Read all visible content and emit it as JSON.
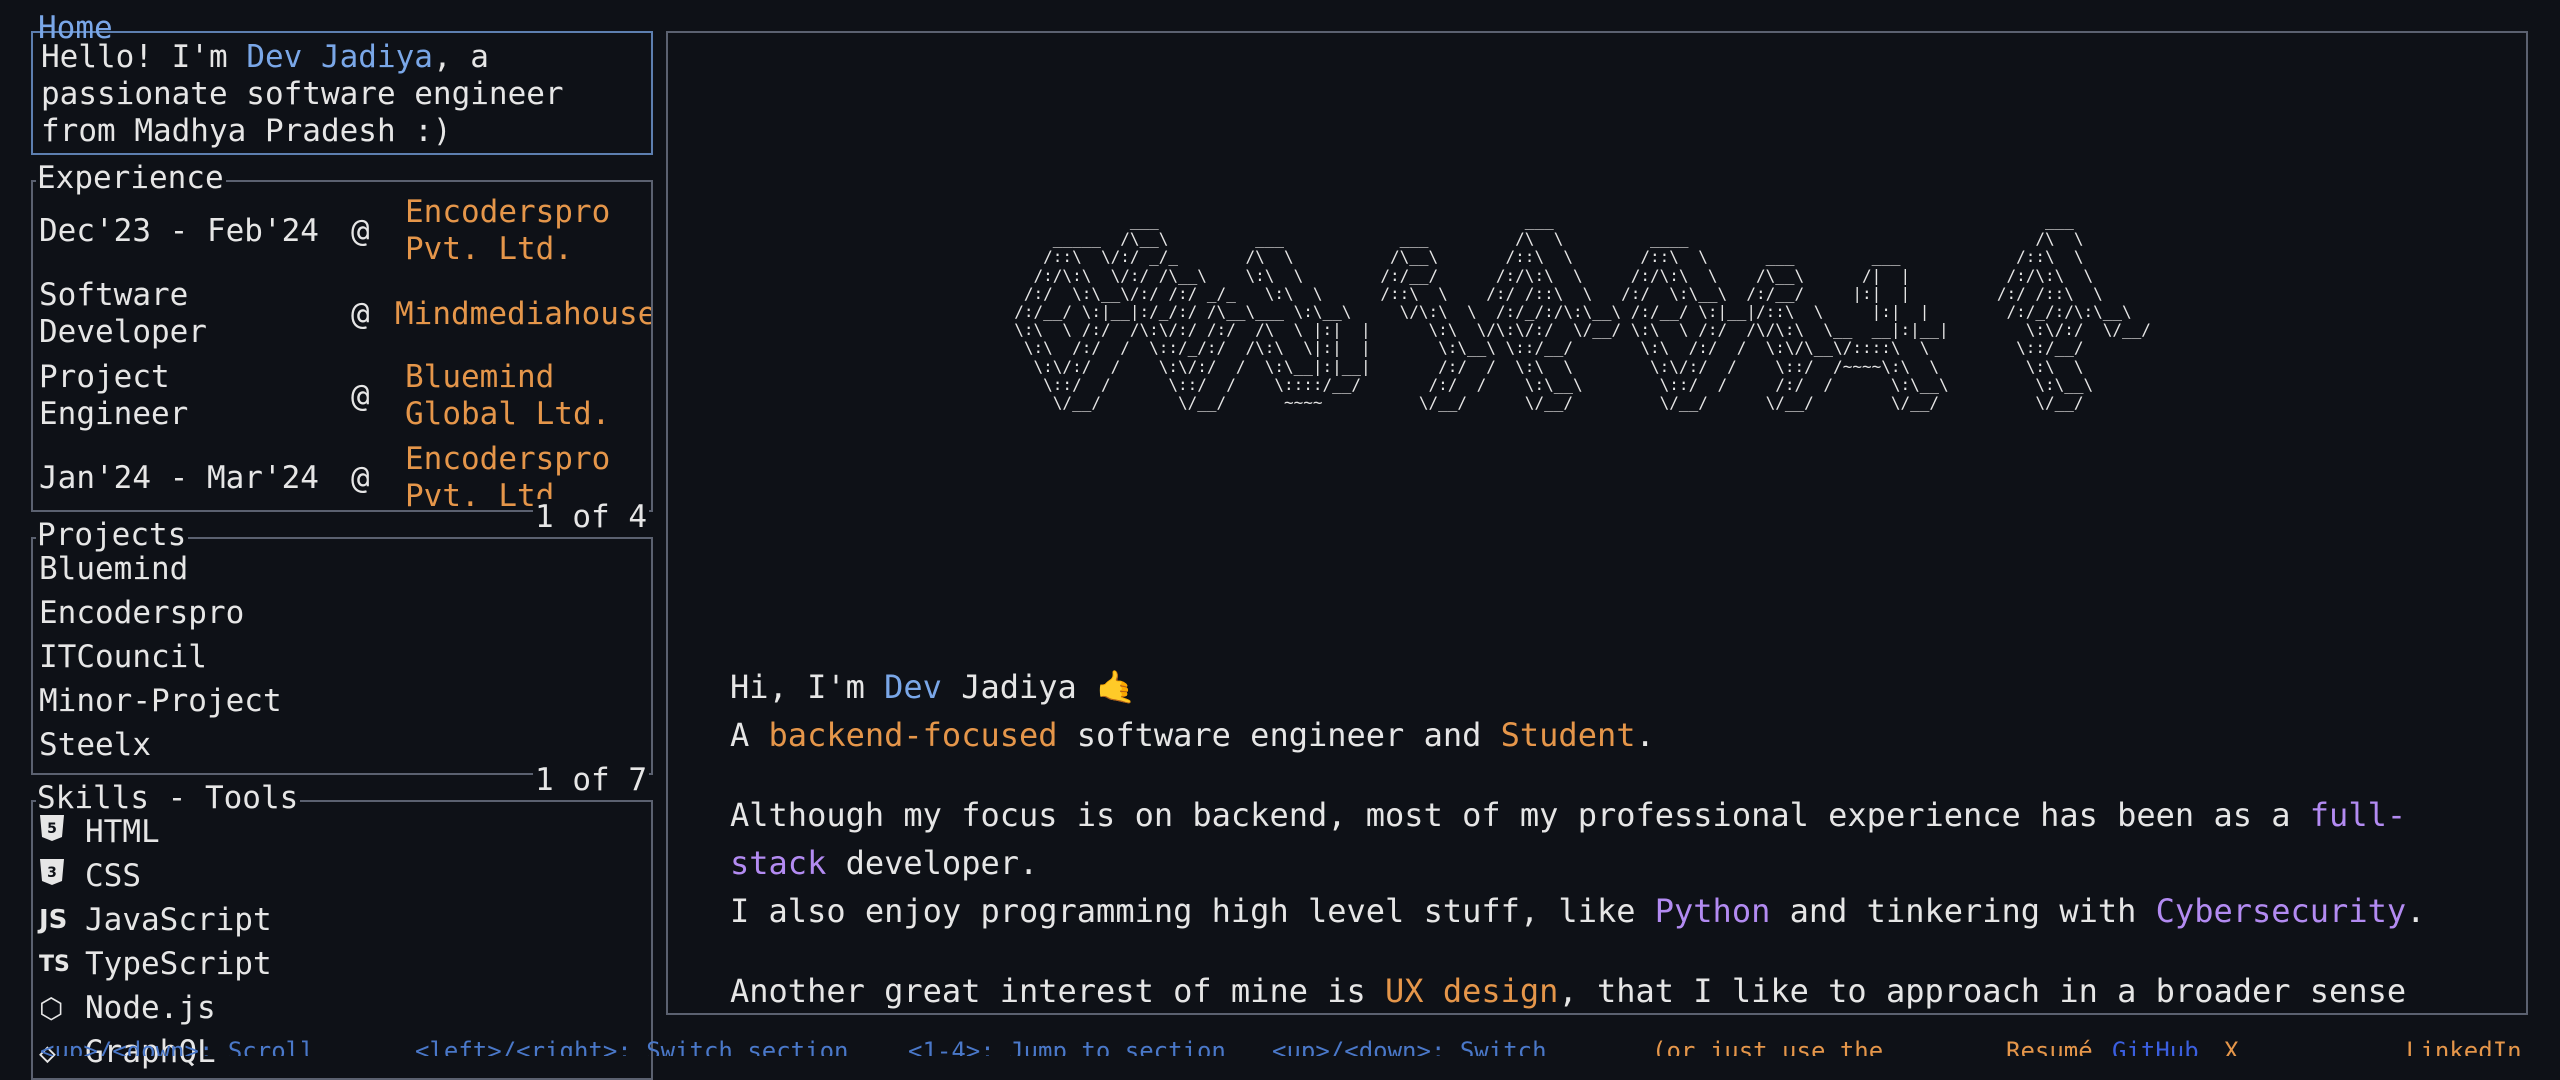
{
  "home": {
    "title": "Home",
    "greeting_prefix": "Hello! I'm ",
    "name": "Dev Jadiya",
    "greeting_line1_suffix": ", a",
    "greeting_line2": "passionate software engineer",
    "greeting_line3": "from Madhya Pradesh :)"
  },
  "experience": {
    "title": "Experience",
    "counter": "1 of 4",
    "items": [
      {
        "left": "Dec'23 - Feb'24",
        "at": "@",
        "company": "Encoderspro\nPvt. Ltd."
      },
      {
        "left": "Software\nDeveloper",
        "at": "@",
        "company": "Mindmediahouse"
      },
      {
        "left": "Project\nEngineer",
        "at": "@",
        "company": "Bluemind\nGlobal Ltd."
      },
      {
        "left": "Jan'24 - Mar'24",
        "at": "@",
        "company": "Encoderspro\nPvt. Ltd."
      }
    ]
  },
  "projects": {
    "title": "Projects",
    "counter": "1 of 7",
    "items": [
      "Bluemind",
      "Encodersp ro",
      "ITCouncil",
      "Minor-Project",
      "Steelx"
    ]
  },
  "skills": {
    "title": "Skills - Tools",
    "items": [
      {
        "icon": "html5-icon",
        "glyph": "5",
        "label": "HTML"
      },
      {
        "icon": "css3-icon",
        "glyph": "3",
        "label": "CSS"
      },
      {
        "icon": "javascript-icon",
        "glyph": "JS",
        "label": "JavaScript"
      },
      {
        "icon": "typescript-icon",
        "glyph": "TS",
        "label": "TypeScript"
      },
      {
        "icon": "nodejs-icon",
        "glyph": "⬡",
        "label": "Node.js"
      },
      {
        "icon": "graphql-icon",
        "glyph": "◇",
        "label": "GraphQL"
      }
    ]
  },
  "main": {
    "intro_prefix": "Hi, I'm ",
    "intro_first": "Dev",
    "intro_last": " Jadiya",
    "intro_emoji": "🤙",
    "line2_a": "A ",
    "line2_b": "backend-focused",
    "line2_c": " software engineer and ",
    "line2_d": "Student",
    "line2_e": ".",
    "p2_a": "Although my focus is on backend, most of my professional experience has been as a ",
    "p2_b": "full-",
    "p2_c": "stack",
    "p2_d": " developer.",
    "p3_a": "I also enjoy programming high level stuff, like ",
    "p3_b": "Python",
    "p3_c": " and tinkering with ",
    "p3_d": "Cybersecurity",
    "p3_e": ".",
    "p4_a": "Another great interest of mine is ",
    "p4_b": "UX design",
    "p4_c": ", that I like to approach in a broader sense"
  },
  "footer": {
    "hint1": "<up>/<down>: Scroll",
    "hint2": "<left>/<right>: Switch section",
    "hint3": "<1-4>: Jump to section",
    "hint4": "<up>/<down>: Switch",
    "hint5": "(or just use the",
    "resume": "Resumé",
    "github": "GitHub",
    "x": "X",
    "linkedin": "LinkedIn"
  },
  "colors": {
    "background": "#0e1117",
    "accent_blue": "#7aa7e8",
    "accent_orange": "#e5964a",
    "accent_purple": "#b38bf2",
    "border": "#5b6170"
  }
}
